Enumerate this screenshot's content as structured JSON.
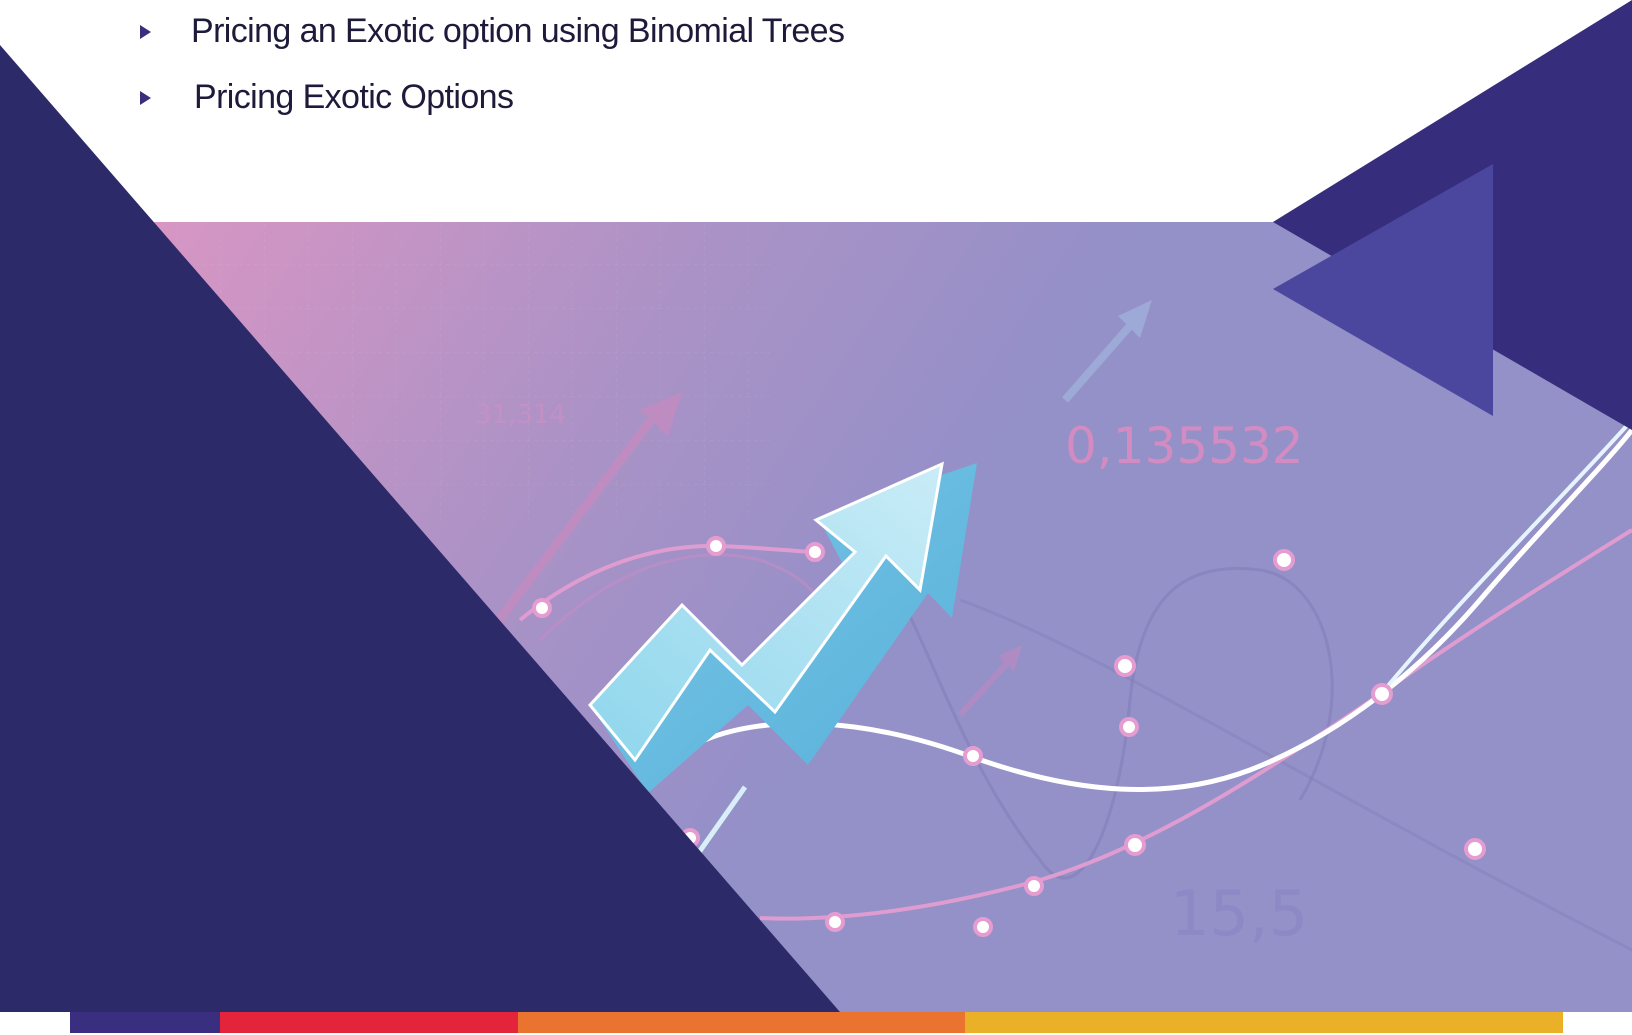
{
  "bullets": [
    "Pricing an Exotic option using Binomial Trees",
    "Pricing Exotic Options"
  ],
  "illustration": {
    "numbers": [
      "31,314",
      "0,135532",
      "15,5"
    ]
  },
  "colors": {
    "navy": "#2d2a6a",
    "indigo": "#362d7c",
    "violet": "#4b479e",
    "panel_start": "#d896c4",
    "panel_end": "#9490c8",
    "stripe_purple": "#3a2e80",
    "stripe_red": "#e4243a",
    "stripe_orange": "#ea7330",
    "stripe_yellow": "#eab028"
  }
}
